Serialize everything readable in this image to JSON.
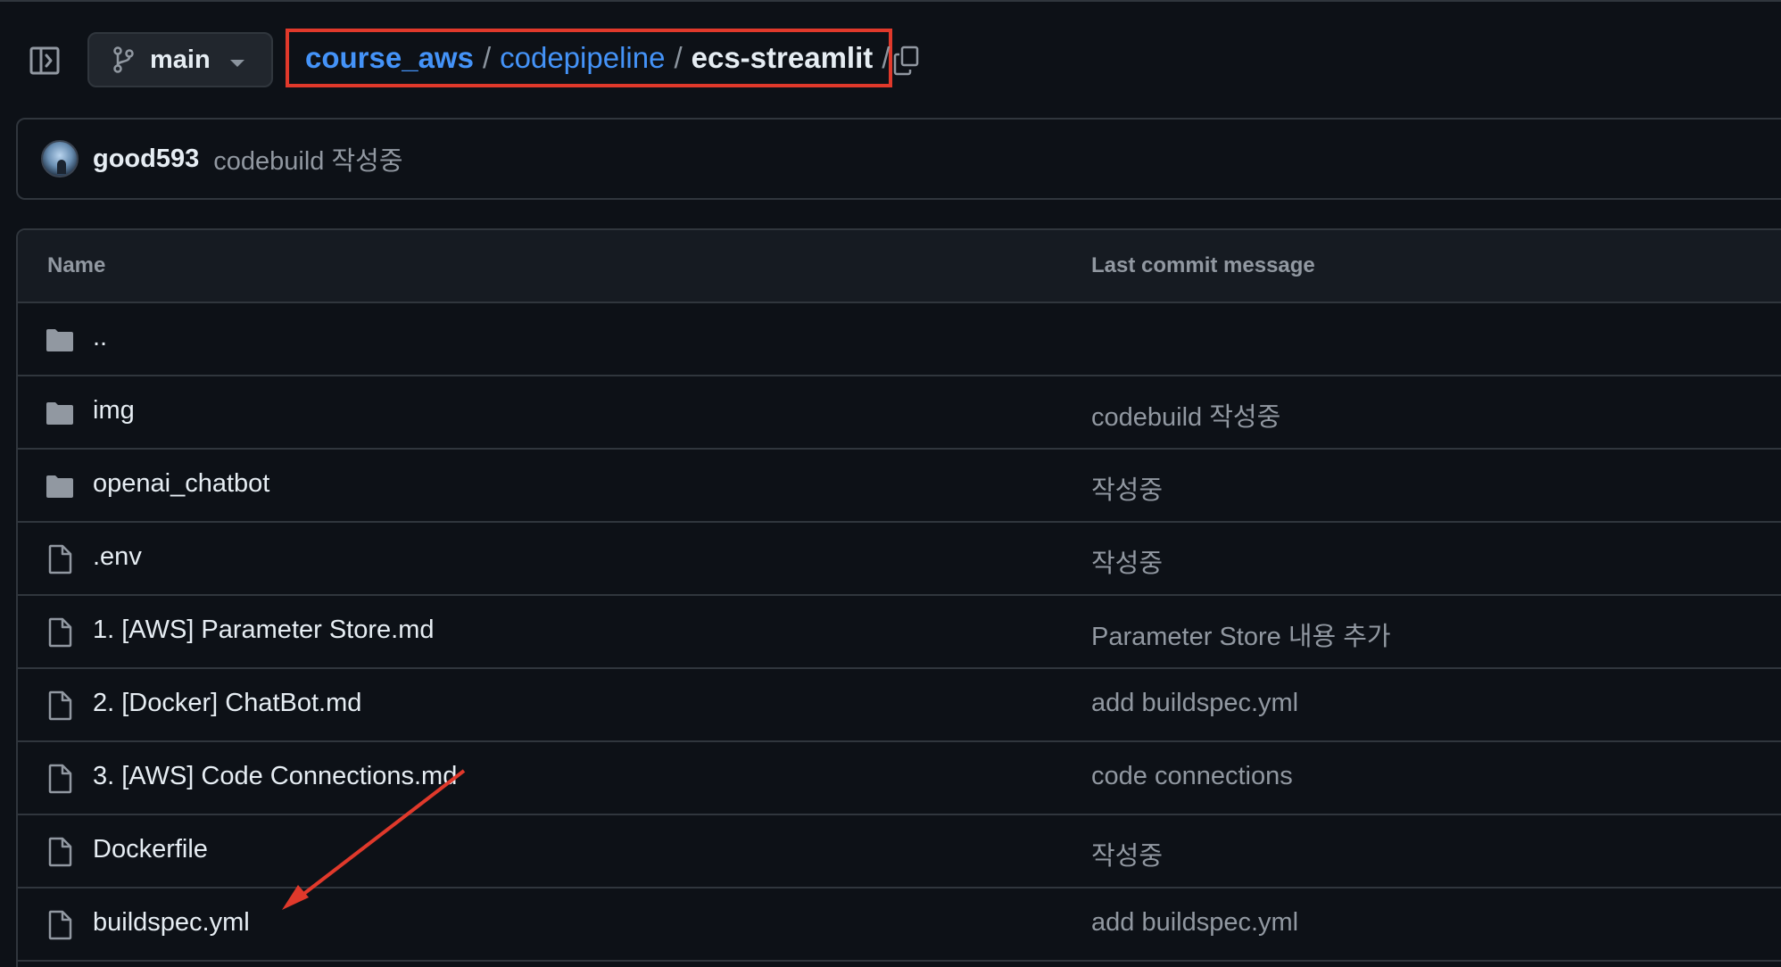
{
  "header": {
    "branch": {
      "label": "main",
      "icon": "git-branch-icon"
    },
    "breadcrumb": {
      "items": [
        "course_aws",
        "codepipeline"
      ],
      "current": "ecs-streamlit",
      "separator": "/"
    }
  },
  "latest_commit": {
    "author": "good593",
    "message": "codebuild 작성중"
  },
  "file_table": {
    "columns": {
      "name": "Name",
      "last_commit_message": "Last commit message"
    },
    "rows": [
      {
        "name": "..",
        "type": "folder",
        "message": ""
      },
      {
        "name": "img",
        "type": "folder",
        "message": "codebuild 작성중"
      },
      {
        "name": "openai_chatbot",
        "type": "folder",
        "message": "작성중"
      },
      {
        "name": ".env",
        "type": "file",
        "message": "작성중"
      },
      {
        "name": "1. [AWS] Parameter Store.md",
        "type": "file",
        "message": "Parameter Store 내용 추가"
      },
      {
        "name": "2. [Docker] ChatBot.md",
        "type": "file",
        "message": "add buildspec.yml"
      },
      {
        "name": "3. [AWS] Code Connections.md",
        "type": "file",
        "message": "code connections"
      },
      {
        "name": "Dockerfile",
        "type": "file",
        "message": "작성중"
      },
      {
        "name": "buildspec.yml",
        "type": "file",
        "message": "add buildspec.yml"
      }
    ]
  },
  "colors": {
    "background": "#0d1117",
    "border": "#30363d",
    "link": "#4493f8",
    "muted_text": "#9198a1",
    "annotation": "#e0392b"
  }
}
